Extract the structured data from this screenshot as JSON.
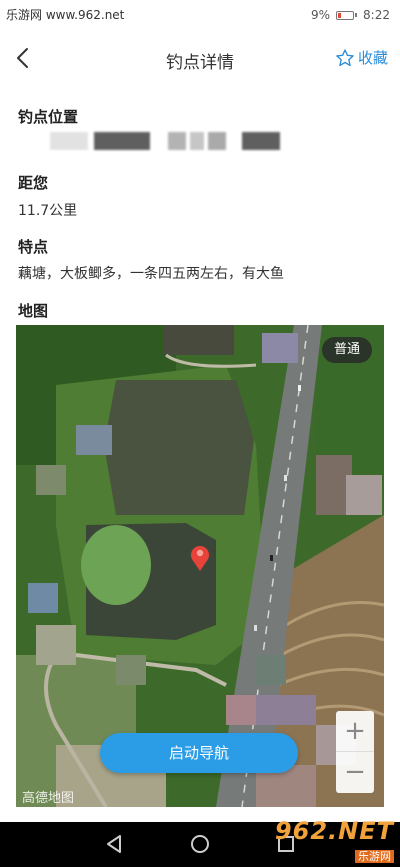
{
  "status_bar": {
    "left_text": "乐游网 www.962.net",
    "battery_percent": "9%",
    "time": "8:22"
  },
  "nav": {
    "title": "钓点详情",
    "favorite_label": "收藏"
  },
  "sections": {
    "location_label": "钓点位置",
    "distance_label": "距您",
    "distance_value": "11.7公里",
    "feature_label": "特点",
    "feature_value": "藕塘，大板鲫多，一条四五两左右，有大鱼",
    "map_label": "地图"
  },
  "map": {
    "type_button": "普通",
    "nav_button": "启动导航",
    "logo": "高德地图",
    "zoom_in": "+",
    "zoom_out": "−"
  },
  "watermark": {
    "big": "962.NET",
    "small": "乐游网"
  },
  "colors": {
    "accent": "#2b8cd8",
    "nav_button": "#2b9ce6",
    "pin": "#e8433a"
  },
  "icons": {
    "back": "chevron-left-icon",
    "favorite": "star-outline-icon",
    "pin": "map-pin-icon",
    "android_back": "triangle-back-icon",
    "android_home": "circle-home-icon",
    "android_recent": "square-recent-icon"
  }
}
